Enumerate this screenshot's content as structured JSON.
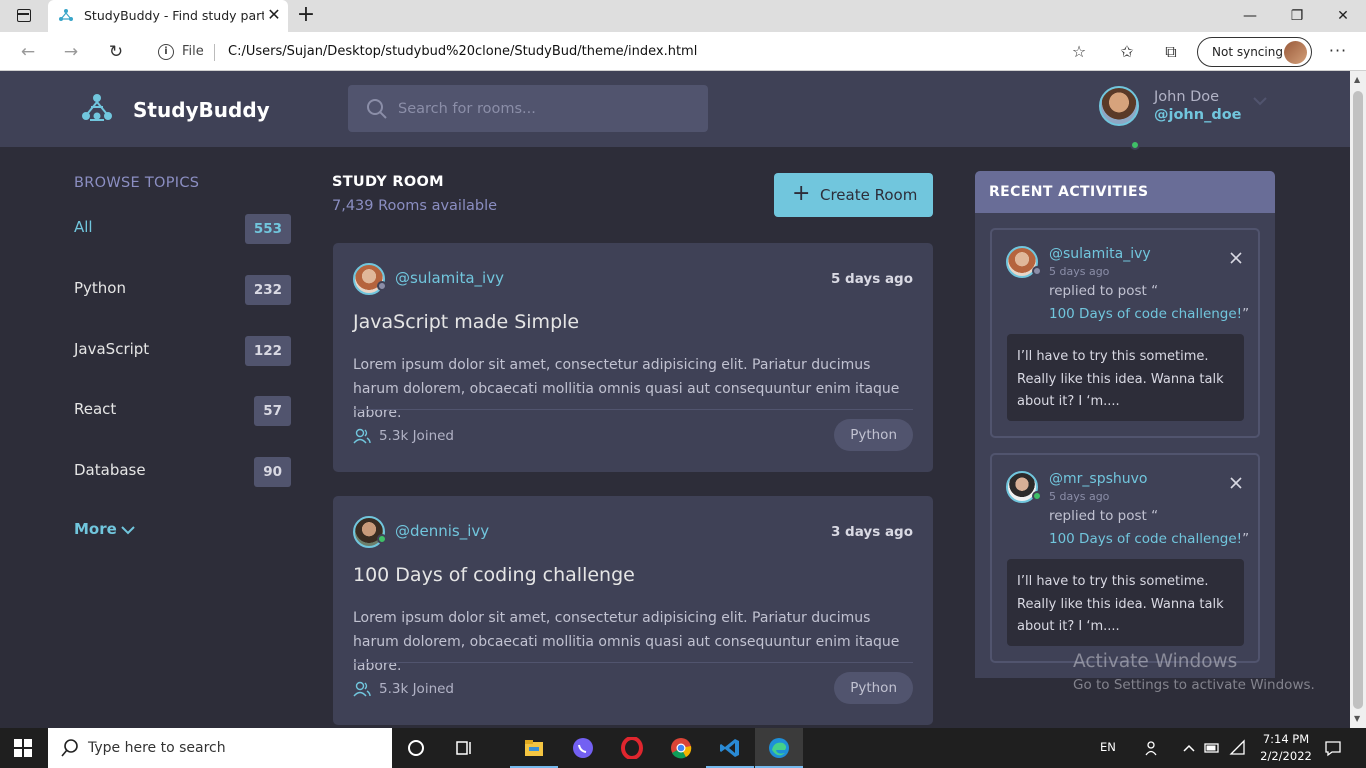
{
  "browser": {
    "tab_title": "StudyBuddy - Find study partners",
    "file_label": "File",
    "url": "C:/Users/Sujan/Desktop/studybud%20clone/StudyBud/theme/index.html",
    "sync_label": "Not syncing"
  },
  "header": {
    "brand": "StudyBuddy",
    "search_placeholder": "Search for rooms...",
    "user_name": "John Doe",
    "user_handle": "@john_doe"
  },
  "topics": {
    "title": "BROWSE TOPICS",
    "items": [
      {
        "label": "All",
        "count": "553"
      },
      {
        "label": "Python",
        "count": "232"
      },
      {
        "label": "JavaScript",
        "count": "122"
      },
      {
        "label": "React",
        "count": "57"
      },
      {
        "label": "Database",
        "count": "90"
      }
    ],
    "more_label": "More"
  },
  "main": {
    "title": "STUDY ROOM",
    "rooms_available": "7,439 Rooms available",
    "create_label": "Create Room",
    "rooms": [
      {
        "host": "@sulamita_ivy",
        "time": "5 days ago",
        "title": "JavaScript made Simple",
        "description": "Lorem ipsum dolor sit amet, consectetur adipisicing elit. Pariatur ducimus harum dolorem, obcaecati mollitia omnis quasi aut consequuntur enim itaque labore.",
        "joined": "5.3k Joined",
        "tag": "Python"
      },
      {
        "host": "@dennis_ivy",
        "time": "3 days ago",
        "title": "100 Days of coding challenge",
        "description": "Lorem ipsum dolor sit amet, consectetur adipisicing elit. Pariatur ducimus harum dolorem, obcaecati mollitia omnis quasi aut consequuntur enim itaque labore.",
        "joined": "5.3k Joined",
        "tag": "Python"
      }
    ]
  },
  "activities": {
    "title": "RECENT ACTIVITIES",
    "items": [
      {
        "user": "@sulamita_ivy",
        "time": "5 days ago",
        "action": "replied to post “",
        "post": "100 Days of code challenge!",
        "post_close": "”",
        "reply": "I’ll have to try this sometime. Really like this idea. Wanna talk about it? I ‘m...."
      },
      {
        "user": "@mr_spshuvo",
        "time": "5 days ago",
        "action": "replied to post “",
        "post": "100 Days of code challenge!",
        "post_close": "”",
        "reply": "I’ll have to try this sometime. Really like this idea. Wanna talk about it? I ‘m...."
      }
    ]
  },
  "watermark": {
    "title": "Activate Windows",
    "subtitle": "Go to Settings to activate Windows."
  },
  "taskbar": {
    "search_placeholder": "Type here to search",
    "language": "EN",
    "time": "7:14 PM",
    "date": "2/2/2022"
  },
  "colors": {
    "accent": "#71c6dd",
    "surface": "#3f4156",
    "background": "#2d2d39",
    "activity_header": "#696d97",
    "online": "#3fbf67"
  }
}
